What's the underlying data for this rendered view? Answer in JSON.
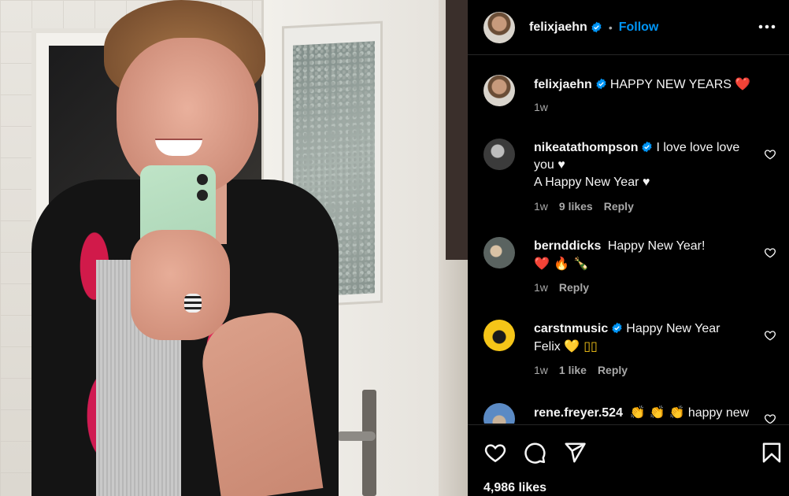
{
  "post": {
    "author": "felixjaehn",
    "follow_label": "Follow",
    "separator": "•",
    "likes_text": "4,986 likes"
  },
  "caption": {
    "username": "felixjaehn",
    "text": "HAPPY NEW YEARS",
    "emoji": "❤️",
    "time": "1w"
  },
  "comments": [
    {
      "username": "nikeatathompson",
      "verified": true,
      "lines": [
        "I love love love you ♥",
        "A Happy New Year ♥"
      ],
      "time": "1w",
      "likes": "9 likes",
      "reply": "Reply"
    },
    {
      "username": "bernddicks",
      "verified": false,
      "lines": [
        "Happy New Year!",
        "❤️ 🔥 🍾"
      ],
      "time": "1w",
      "likes": "",
      "reply": "Reply"
    },
    {
      "username": "carstnmusic",
      "verified": true,
      "lines": [
        "Happy New Year Felix 💛 󠁧󠁢󠁥󠁮󠁧󠁿󠁧󠁢󠁥󠁮󠁧󠁿"
      ],
      "line_text": "Happy New Year",
      "line2_text": "Felix",
      "line2_emoji": "💛 ▯▯",
      "time": "1w",
      "likes": "1 like",
      "reply": "Reply"
    },
    {
      "username": "rene.freyer.524",
      "verified": false,
      "lines": [
        "👏 👏 👏 happy new"
      ],
      "emoji": "👏 👏 👏",
      "text": "happy new",
      "time": "",
      "likes": "",
      "reply": ""
    }
  ],
  "colors": {
    "background": "#000000",
    "text": "#f5f5f5",
    "muted": "#a8a8a8",
    "link": "#0095f6",
    "verified": "#0095f6",
    "divider": "#262626",
    "heart": "#ff3040"
  },
  "icons": {
    "header_more": "more-horizontal-icon",
    "verified": "verified-badge-icon",
    "comment_like": "heart-outline-icon",
    "like": "heart-outline-icon",
    "comment": "comment-bubble-icon",
    "share": "paper-plane-icon",
    "save": "bookmark-icon"
  }
}
